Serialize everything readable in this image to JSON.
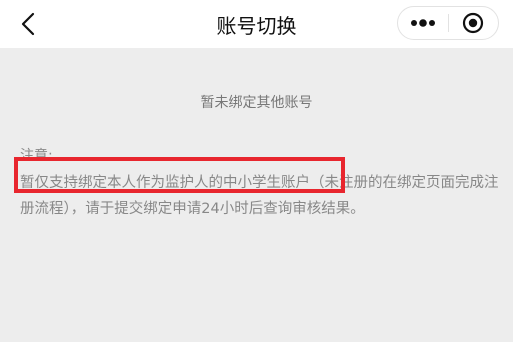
{
  "nav": {
    "title": "账号切换",
    "back_icon": "chevron-left-icon",
    "more_icon": "more-dots-icon",
    "close_icon": "target-circle-icon"
  },
  "main": {
    "empty_text": "暂未绑定其他账号",
    "note_label": "注意:",
    "note_highlight": "暂仅支持绑定本人作为监护人的中小学生账户",
    "note_rest": "（未注册的在绑定页面完成注册流程），请于提交绑定申请24小时后查询审核结果。"
  },
  "colors": {
    "highlight_border": "#e8262e",
    "background": "#ededed",
    "navbar": "#ffffff"
  }
}
